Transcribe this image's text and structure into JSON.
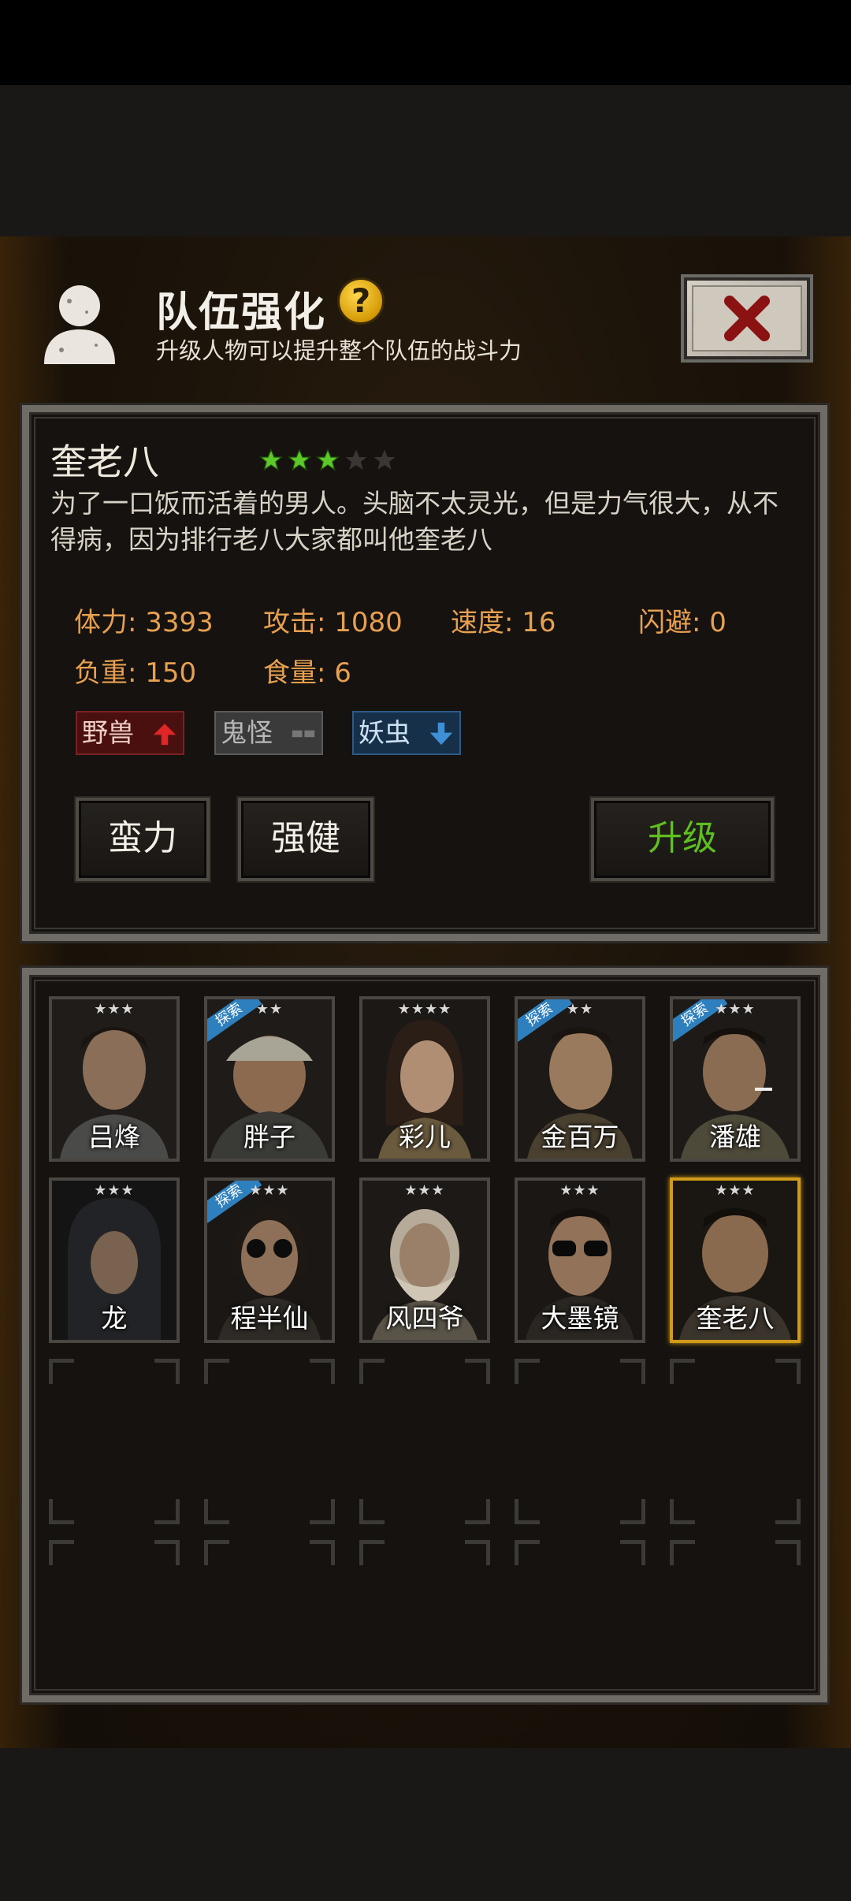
{
  "header": {
    "title": "队伍强化",
    "help_icon": "?",
    "subtitle": "升级人物可以提升整个队伍的战斗力"
  },
  "hero": {
    "name": "奎老八",
    "stars_filled": 3,
    "stars_total": 5,
    "description": "为了一口饭而活着的男人。头脑不太灵光，但是力气很大，从不得病，因为排行老八大家都叫他奎老八",
    "stats": {
      "stamina": "体力: 3393",
      "attack": "攻击: 1080",
      "speed": "速度: 16",
      "dodge": "闪避: 0",
      "load": "负重: 150",
      "food": "食量: 6"
    },
    "tags": {
      "beast": "野兽",
      "ghost": "鬼怪",
      "bug": "妖虫"
    },
    "buttons": {
      "skill1": "蛮力",
      "skill2": "强健",
      "upgrade": "升级"
    }
  },
  "roster": {
    "cards": [
      {
        "name": "吕烽",
        "stars": "★★★",
        "badge": ""
      },
      {
        "name": "胖子",
        "stars": "★★",
        "badge": "探索"
      },
      {
        "name": "彩儿",
        "stars": "★★★★",
        "badge": ""
      },
      {
        "name": "金百万",
        "stars": "★★",
        "badge": "探索"
      },
      {
        "name": "潘雄",
        "stars": "★★★",
        "badge": "探索"
      },
      {
        "name": "龙",
        "stars": "★★★",
        "badge": ""
      },
      {
        "name": "程半仙",
        "stars": "★★★",
        "badge": "探索"
      },
      {
        "name": "风四爷",
        "stars": "★★★",
        "badge": ""
      },
      {
        "name": "大墨镜",
        "stars": "★★★",
        "badge": ""
      },
      {
        "name": "奎老八",
        "stars": "★★★",
        "badge": ""
      }
    ]
  },
  "colors": {
    "stat_orange": "#e7a050",
    "upgrade_green": "#5fbf1f",
    "selected_gold": "#d09a1a",
    "star_green": "#5cc82a"
  }
}
